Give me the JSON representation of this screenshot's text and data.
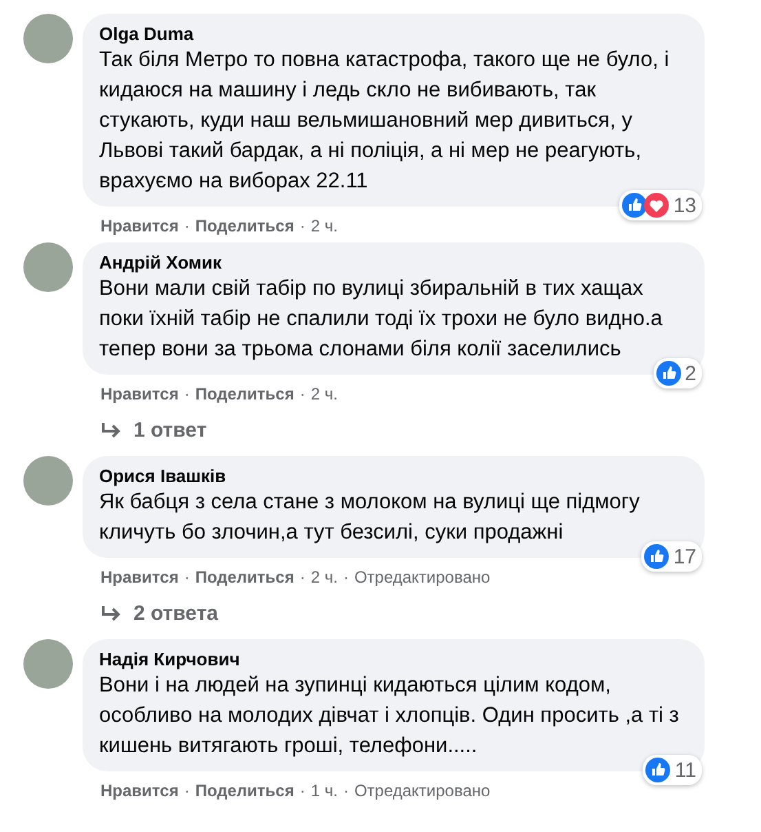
{
  "comments": [
    {
      "author": "Olga Duma",
      "text": "Так біля Метро то повна катастрофа, такого ще не було, і кидаюся на машину і ледь скло не вибивають, так стукають, куди наш вельмишановний мер дивиться, у Львові такий бардак, а ні поліція, а ні мер не реагують, врахуємо на виборах 22.11",
      "reactions": [
        {
          "kind": "like"
        },
        {
          "kind": "love"
        }
      ],
      "reaction_count": "13",
      "meta": [
        {
          "kind": "action",
          "text": "Нравится"
        },
        {
          "kind": "sep",
          "text": "·"
        },
        {
          "kind": "action",
          "text": "Поделиться"
        },
        {
          "kind": "sep",
          "text": "·"
        },
        {
          "kind": "time",
          "text": "2 ч."
        }
      ]
    },
    {
      "author": "Андрій Хомик",
      "text": "Вони мали свій табір по вулиці збиральній в тих хащах поки їхній табір не спалили тоді їх трохи не було видно.а тепер вони за трьома слонами біля колії заселились",
      "reactions": [
        {
          "kind": "like"
        }
      ],
      "reaction_count": "2",
      "meta": [
        {
          "kind": "action",
          "text": "Нравится"
        },
        {
          "kind": "sep",
          "text": "·"
        },
        {
          "kind": "action",
          "text": "Поделиться"
        },
        {
          "kind": "sep",
          "text": "·"
        },
        {
          "kind": "time",
          "text": "2 ч."
        }
      ],
      "replies": "1 ответ"
    },
    {
      "author": "Орися Івашків",
      "text": "Як бабця з села стане з молоком на вулиці ще підмогу кличуть бо злочин,а тут безсилі, суки продажні",
      "reactions": [
        {
          "kind": "like"
        }
      ],
      "reaction_count": "17",
      "meta": [
        {
          "kind": "action",
          "text": "Нравится"
        },
        {
          "kind": "sep",
          "text": "·"
        },
        {
          "kind": "action",
          "text": "Поделиться"
        },
        {
          "kind": "sep",
          "text": "·"
        },
        {
          "kind": "time",
          "text": "2 ч."
        },
        {
          "kind": "sep",
          "text": "·"
        },
        {
          "kind": "time",
          "text": "Отредактировано"
        }
      ],
      "replies": "2 ответа"
    },
    {
      "author": "Надія Кирчович",
      "text": "Вони і на людей на зупинці кидаються цілим кодом, особливо на молодих дівчат і хлопців. Один просить ,а ті з кишень витягають гроші, телефони.....",
      "reactions": [
        {
          "kind": "like"
        }
      ],
      "reaction_count": "11",
      "meta": [
        {
          "kind": "action",
          "text": "Нравится"
        },
        {
          "kind": "sep",
          "text": "·"
        },
        {
          "kind": "action",
          "text": "Поделиться"
        },
        {
          "kind": "sep",
          "text": "·"
        },
        {
          "kind": "time",
          "text": "1 ч."
        },
        {
          "kind": "sep",
          "text": "·"
        },
        {
          "kind": "time",
          "text": "Отредактировано"
        }
      ]
    }
  ]
}
